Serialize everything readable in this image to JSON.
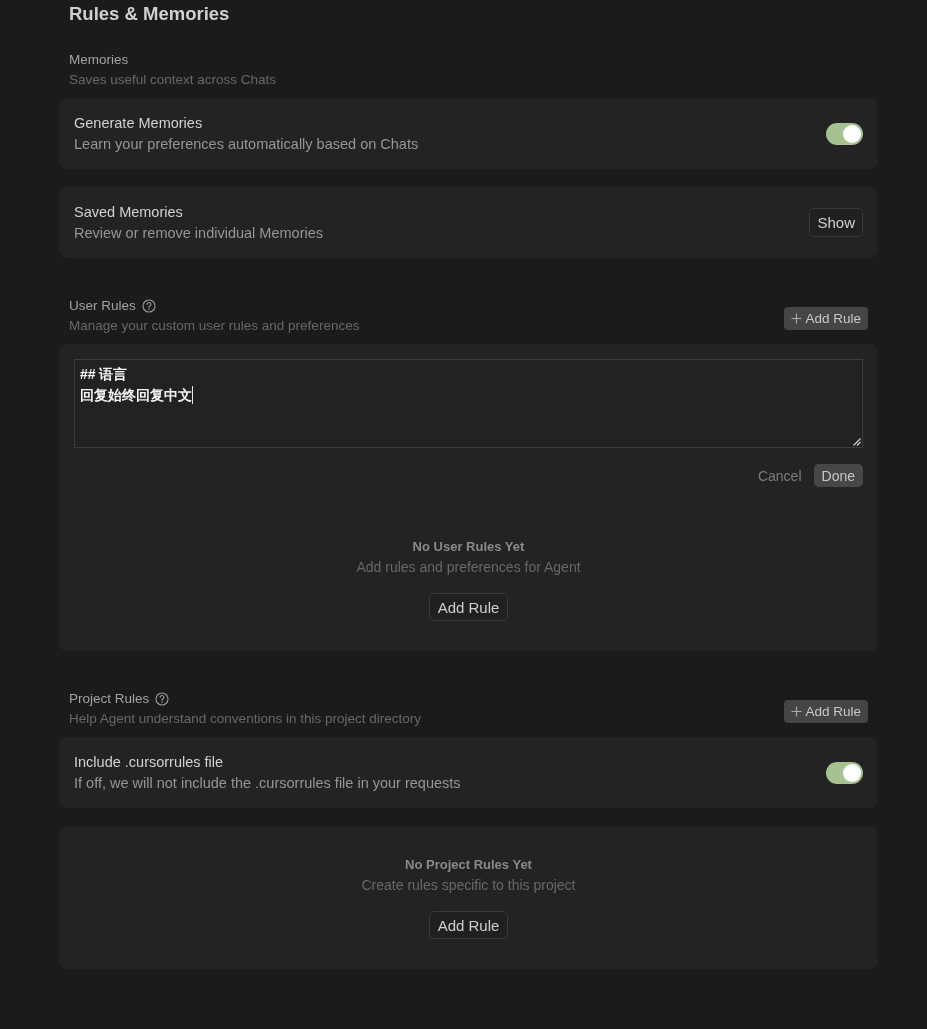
{
  "title": "Rules & Memories",
  "sections": [
    {
      "label": "Memories",
      "description": "Saves useful context across Chats",
      "cards": [
        {
          "kind": "toggle",
          "title": "Generate Memories",
          "description": "Learn your preferences automatically based on Chats",
          "on": true
        },
        {
          "kind": "action",
          "title": "Saved Memories",
          "description": "Review or remove individual Memories",
          "button": "Show"
        }
      ]
    },
    {
      "label": "User Rules",
      "help_icon": true,
      "description": "Manage your custom user rules and preferences",
      "add_button": "Add Rule",
      "cards": [
        {
          "kind": "editor",
          "lines": [
            "## 语言",
            "回复始终回复中文"
          ],
          "actions": [
            {
              "kind": "plain",
              "label": "Cancel"
            },
            {
              "kind": "filled",
              "label": "Done"
            }
          ],
          "empty_title": "No User Rules Yet",
          "empty_text": "Add rules and preferences for Agent",
          "button": "Add Rule"
        }
      ]
    },
    {
      "label": "Project Rules",
      "help_icon": true,
      "description": "Help Agent understand conventions in this project directory",
      "add_button": "Add Rule",
      "cards": [
        {
          "kind": "toggle",
          "title": "Include .cursorrules file",
          "description": "If off, we will not include the .cursorrules file in your requests",
          "on": true
        },
        {
          "kind": "empty",
          "title": "No Project Rules Yet",
          "text": "Create rules specific to this project",
          "button": "Add Rule"
        }
      ]
    }
  ]
}
